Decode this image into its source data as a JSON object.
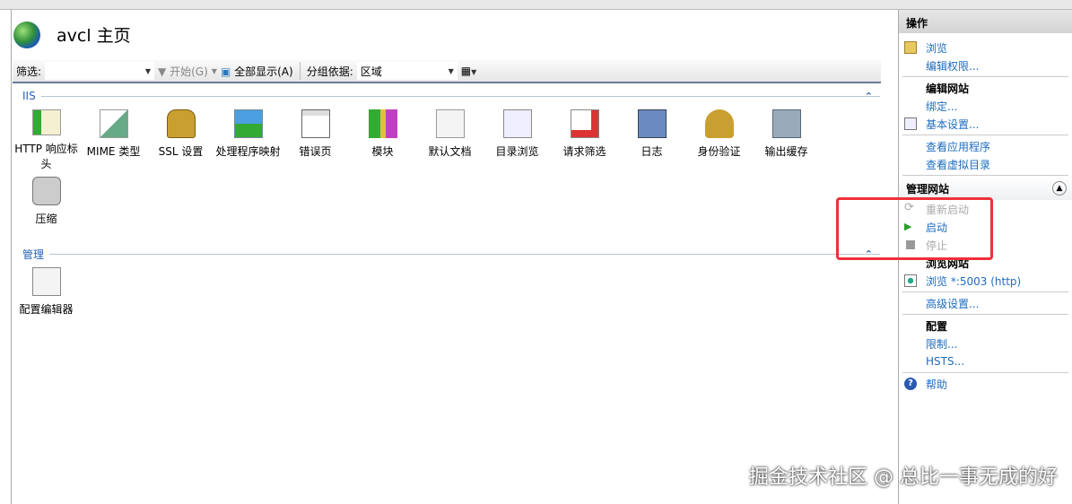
{
  "header": {
    "title": "avcl 主页"
  },
  "toolbar": {
    "filter_label": "筛选:",
    "filter_value": "",
    "go_label": "开始(G)",
    "show_all_label": "全部显示(A)",
    "group_by_label": "分组依据:",
    "group_by_value": "区域"
  },
  "groups": [
    {
      "name": "IIS",
      "items": [
        "HTTP 响应标头",
        "MIME 类型",
        "SSL 设置",
        "处理程序映射",
        "错误页",
        "模块",
        "默认文档",
        "目录浏览",
        "请求筛选",
        "日志",
        "身份验证",
        "输出缓存",
        "压缩"
      ]
    },
    {
      "name": "管理",
      "items": [
        "配置编辑器"
      ]
    }
  ],
  "actions": {
    "title": "操作",
    "browse": "浏览",
    "edit_permissions": "编辑权限...",
    "edit_site": "编辑网站",
    "bindings": "绑定...",
    "basic_settings": "基本设置...",
    "view_apps": "查看应用程序",
    "view_vdirs": "查看虚拟目录",
    "manage_site": "管理网站",
    "restart": "重新启动",
    "start": "启动",
    "stop": "停止",
    "browse_site": "浏览网站",
    "browse_http": "浏览 *:5003 (http)",
    "advanced": "高级设置...",
    "config": "配置",
    "limits": "限制...",
    "hsts": "HSTS...",
    "help": "帮助"
  },
  "watermark": "掘金技术社区 @ 总比一事无成的好"
}
